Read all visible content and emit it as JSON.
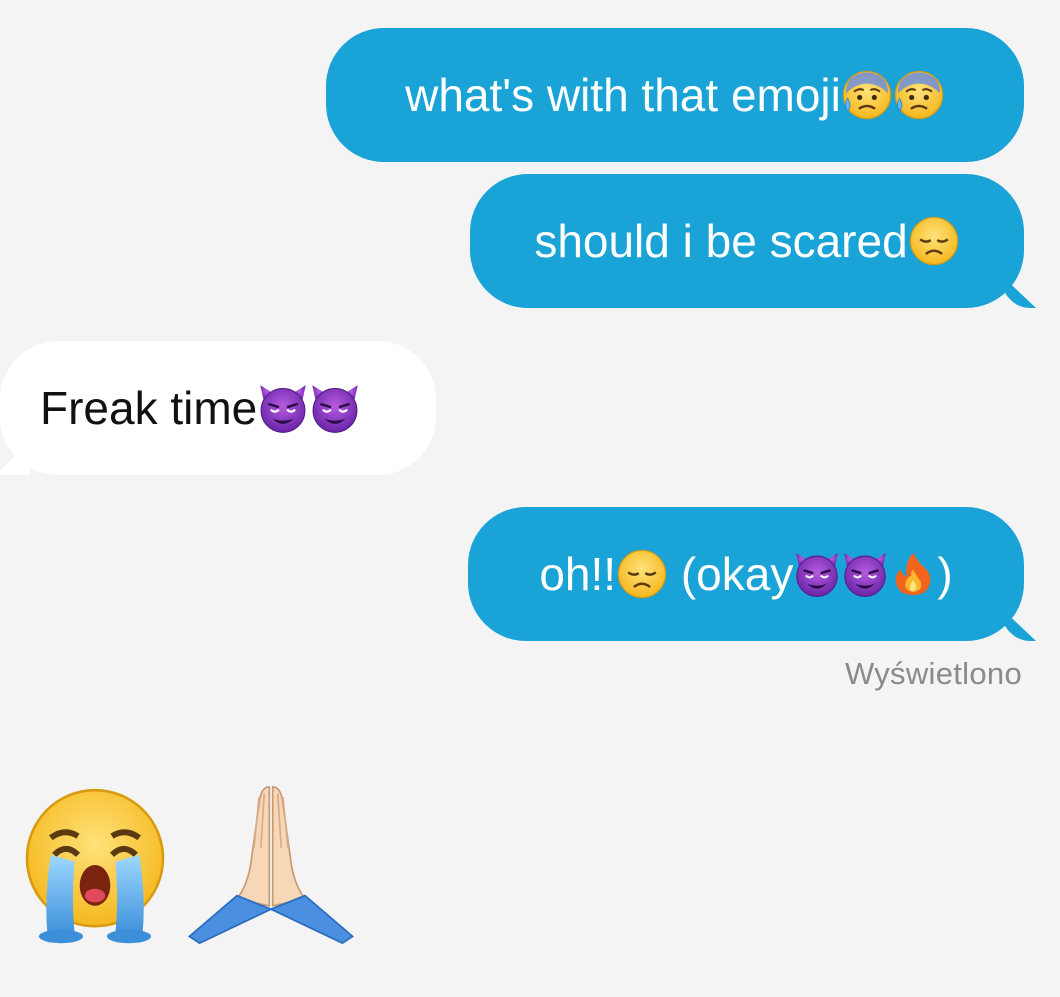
{
  "conversation": {
    "messages": [
      {
        "direction": "outgoing",
        "text": "what's with that emoji",
        "emojis": [
          "anxious-face-with-sweat",
          "anxious-face-with-sweat"
        ]
      },
      {
        "direction": "outgoing",
        "text": "should i be scared",
        "emojis": [
          "disappointed-face"
        ]
      },
      {
        "direction": "incoming",
        "text": "Freak time",
        "emojis": [
          "smiling-face-with-horns",
          "smiling-face-with-horns"
        ]
      },
      {
        "direction": "outgoing",
        "text_parts": [
          "oh!!",
          " (okay",
          ")"
        ],
        "emojis": [
          "disappointed-face",
          "smiling-face-with-horns",
          "smiling-face-with-horns",
          "fire"
        ]
      }
    ],
    "seen_label": "Wyświetlono",
    "bottom_emojis": [
      "loudly-crying-face",
      "folded-hands"
    ]
  },
  "colors": {
    "background": "#f4f4f4",
    "outgoing_bubble": "#19a3d6",
    "incoming_bubble": "#ffffff",
    "seen_text": "#8a8a8a"
  }
}
